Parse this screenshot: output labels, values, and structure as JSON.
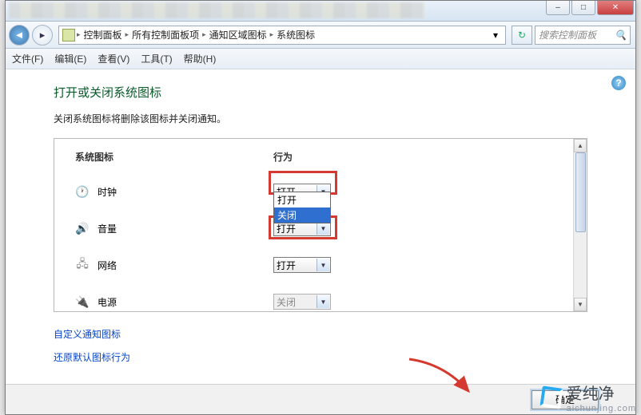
{
  "window_controls": {
    "min": "–",
    "max": "□",
    "close": "✕"
  },
  "nav": {
    "back": "◄",
    "forward": "▸"
  },
  "breadcrumb": {
    "icon": "control-panel-icon",
    "items": [
      "控制面板",
      "所有控制面板项",
      "通知区域图标",
      "系统图标"
    ],
    "sep": "▸",
    "dropdown": "▾"
  },
  "refresh": "↻",
  "search": {
    "placeholder": "搜索控制面板",
    "icon": "🔍"
  },
  "menubar": [
    "文件(F)",
    "编辑(E)",
    "查看(V)",
    "工具(T)",
    "帮助(H)"
  ],
  "help_icon": "?",
  "page": {
    "title": "打开或关闭系统图标",
    "desc": "关闭系统图标将删除该图标并关闭通知。"
  },
  "columns": {
    "name": "系统图标",
    "action": "行为"
  },
  "options": {
    "open": "打开",
    "close": "关闭"
  },
  "rows": [
    {
      "label": "时钟",
      "value_key": "open",
      "disabled": false
    },
    {
      "label": "音量",
      "value_key": "open",
      "disabled": false
    },
    {
      "label": "网络",
      "value_key": "open",
      "disabled": false
    },
    {
      "label": "电源",
      "value_key": "close",
      "disabled": true
    }
  ],
  "dropdown_open": {
    "row_index": 0,
    "selected_key": "close",
    "options_order": [
      "open",
      "close"
    ]
  },
  "links": {
    "customize": "自定义通知图标",
    "restore": "还原默认图标行为"
  },
  "footer": {
    "ok": "确定"
  },
  "watermark": {
    "cn": "爱纯净",
    "url": "aichunjing.com"
  }
}
